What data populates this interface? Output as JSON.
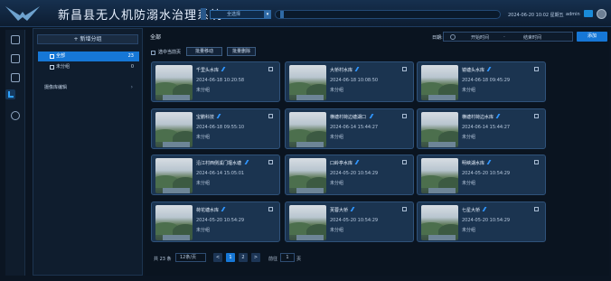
{
  "header": {
    "title": "新昌县无人机防溺水治理系统",
    "select_value": "全选择",
    "datetime": "2024-06-20 10:02 星期五",
    "user": "admin"
  },
  "sidebar": {
    "add_group": "+ 新增分组",
    "groups": [
      {
        "label": "全部",
        "count": "23"
      },
      {
        "label": "未分组",
        "count": "0"
      }
    ],
    "library": "摄像库编辑"
  },
  "toolbar": {
    "title": "全部",
    "date_label": "日期:",
    "date_start": "开始时间",
    "date_sep": "-",
    "date_end": "结束时间",
    "add_button": "添加",
    "select_page": "选中当前页",
    "move_button": "批量移动",
    "delete_button": "批量删除"
  },
  "cards": [
    {
      "name": "千里头水库",
      "time": "2024-06-18 10:20:58",
      "group": "未分组"
    },
    {
      "name": "大桥村水库",
      "time": "2024-06-18 10:08:50",
      "group": "未分组"
    },
    {
      "name": "镜塘头水库",
      "time": "2024-06-18 09:45:29",
      "group": "未分组"
    },
    {
      "name": "宝鹏科技",
      "time": "2024-06-18 09:55:10",
      "group": "未分组"
    },
    {
      "name": "横塘村荷边塘湖口",
      "time": "2024-06-14 15:44:27",
      "group": "未分组"
    },
    {
      "name": "横塘村荷边水库",
      "time": "2024-06-14 15:44:27",
      "group": "未分组"
    },
    {
      "name": "沿江村西侧溪门堰水塘",
      "time": "2024-06-14 15:05:01",
      "group": "未分组"
    },
    {
      "name": "口岭亭水库",
      "time": "2024-05-20 10:54:29",
      "group": "未分组"
    },
    {
      "name": "明峡湖水库",
      "time": "2024-05-20 10:54:29",
      "group": "未分组"
    },
    {
      "name": "荷花塘水库",
      "time": "2024-05-20 10:54:29",
      "group": "未分组"
    },
    {
      "name": "芙蓉大桥",
      "time": "2024-05-20 10:54:29",
      "group": "未分组"
    },
    {
      "name": "七星大桥",
      "time": "2024-05-20 10:54:29",
      "group": "未分组"
    }
  ],
  "pager": {
    "total": "共 23 条",
    "page_size": "12条/页",
    "pages": [
      "1",
      "2",
      ">"
    ],
    "prev": "<",
    "goto_label": "前往",
    "goto_value": "1",
    "goto_unit": "页"
  }
}
